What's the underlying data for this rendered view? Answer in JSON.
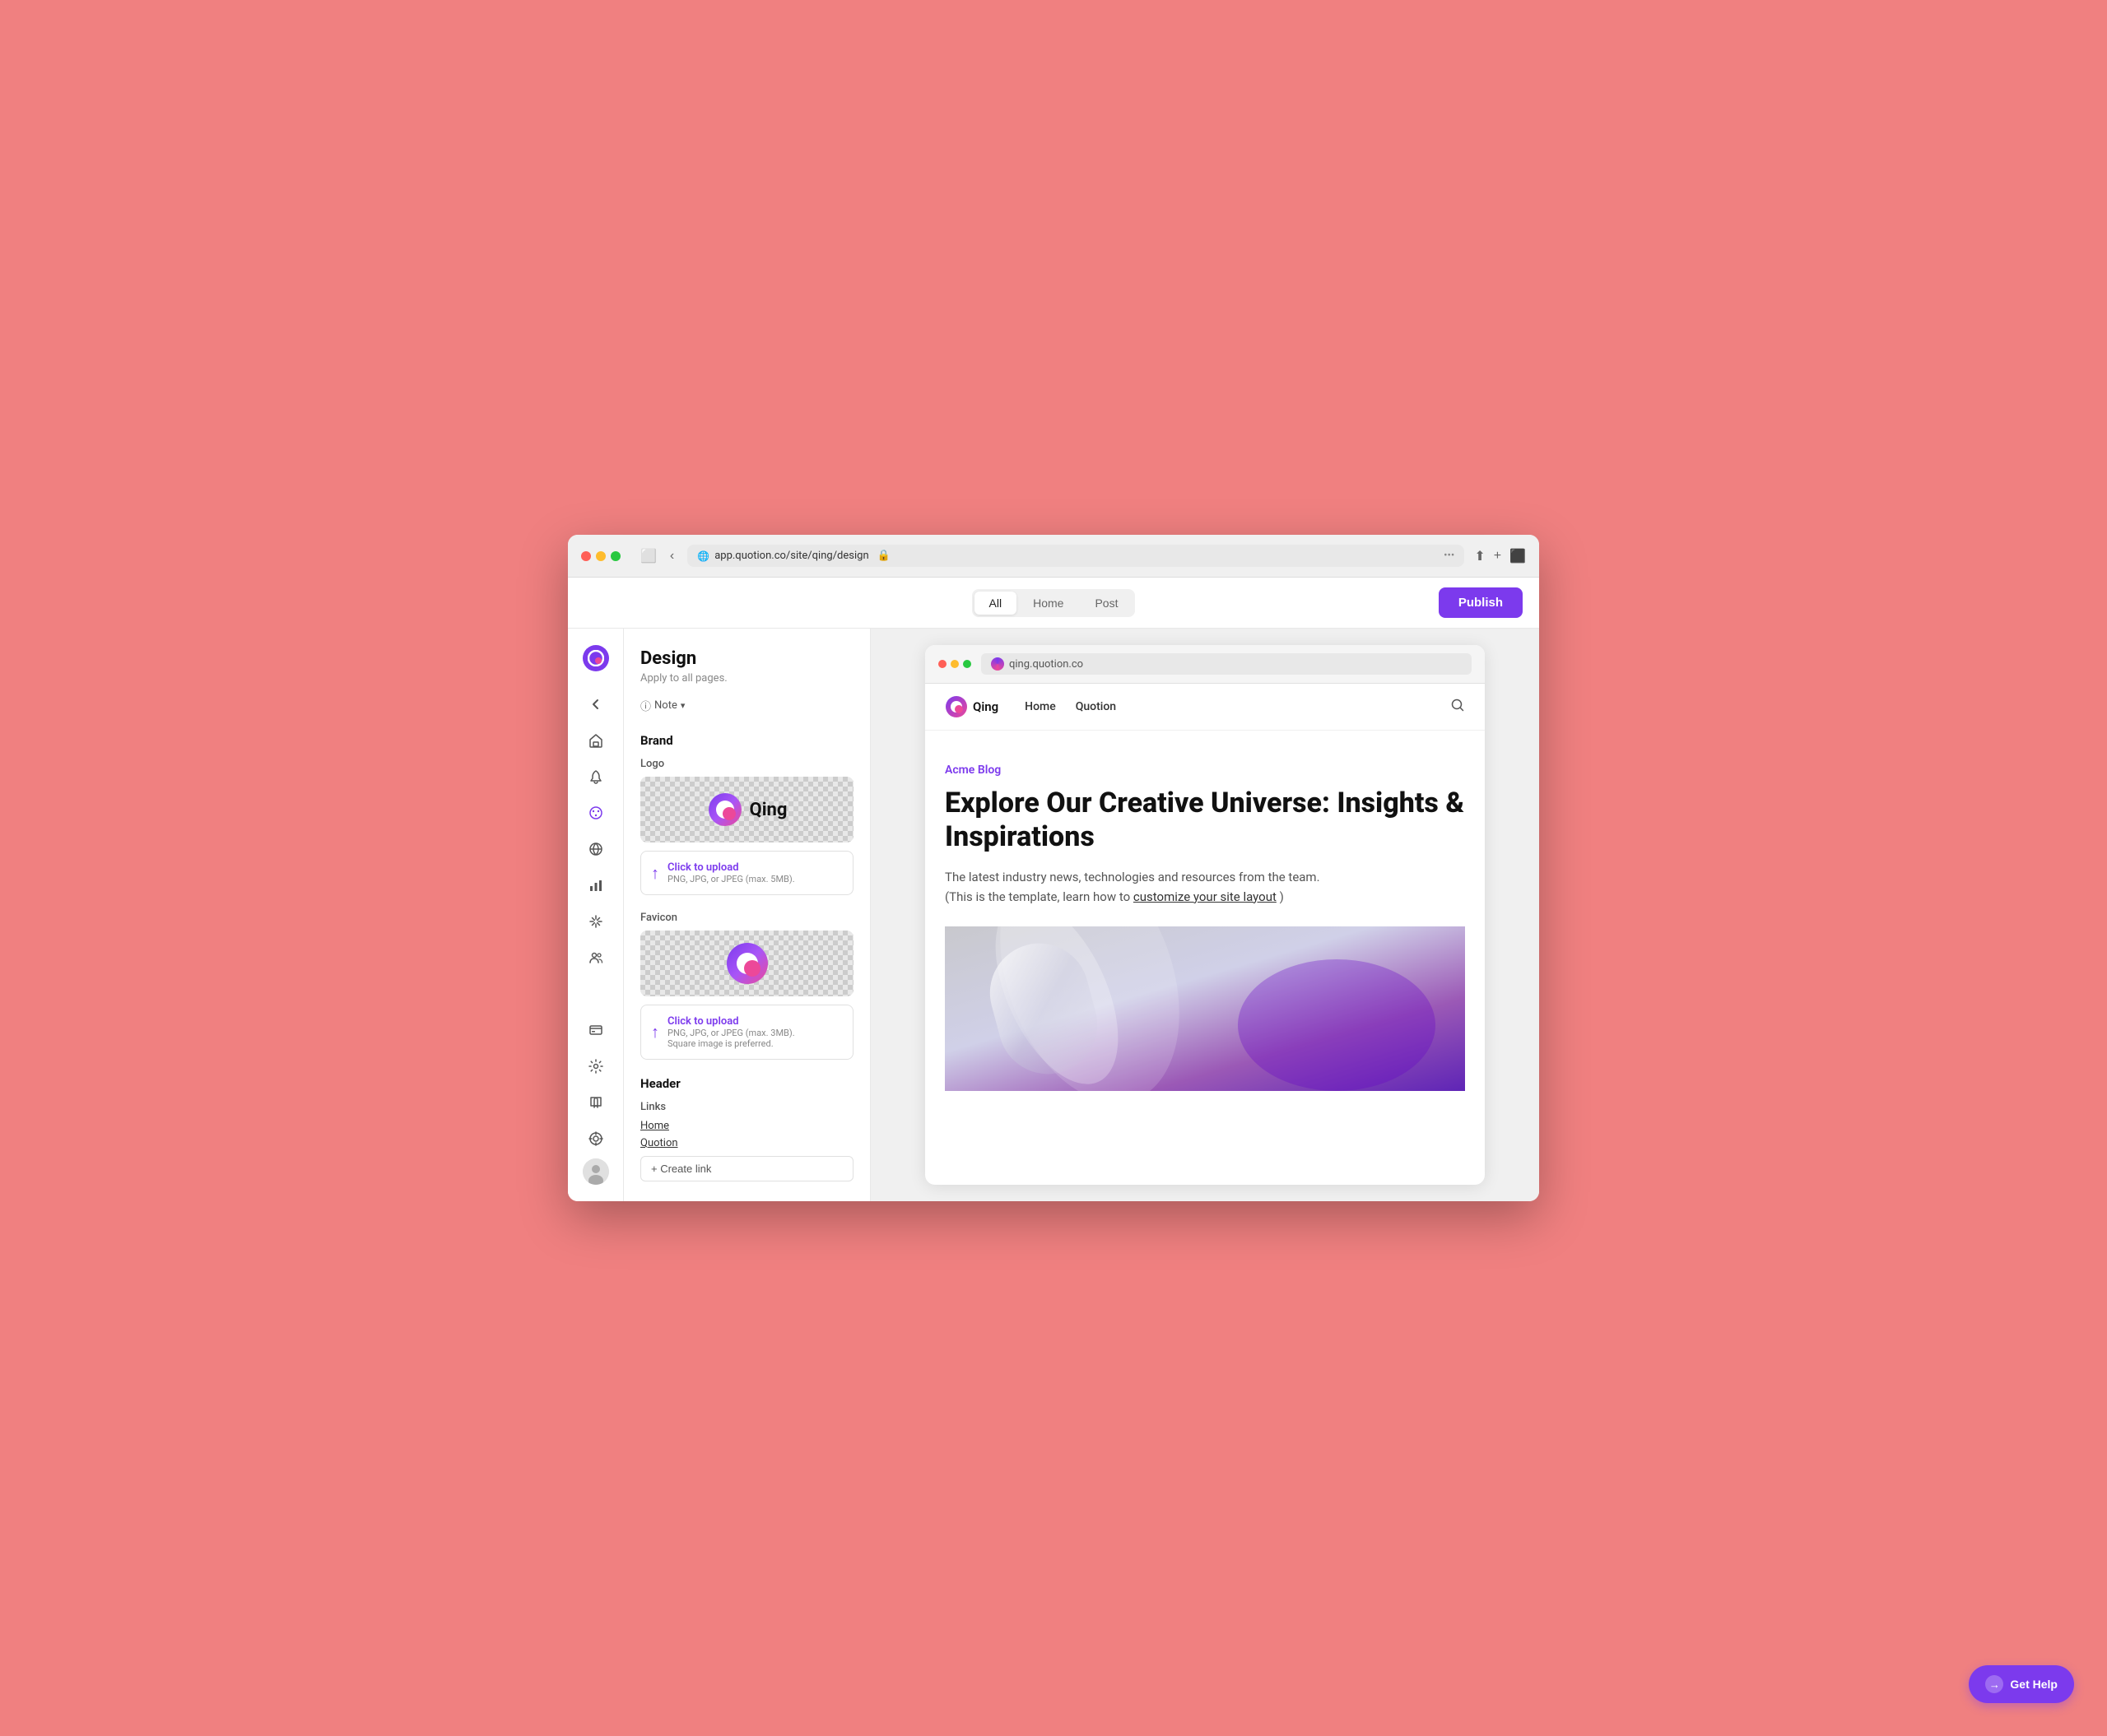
{
  "browser": {
    "url": "app.quotion.co/site/qing/design",
    "lock_icon": "🔒"
  },
  "topbar": {
    "tabs": [
      {
        "id": "all",
        "label": "All",
        "active": true
      },
      {
        "id": "home",
        "label": "Home",
        "active": false
      },
      {
        "id": "post",
        "label": "Post",
        "active": false
      }
    ],
    "publish_label": "Publish"
  },
  "sidebar": {
    "logo": "Q",
    "icons": [
      {
        "id": "back",
        "symbol": "←",
        "label": "back-icon"
      },
      {
        "id": "home",
        "symbol": "⌂",
        "label": "home-icon"
      },
      {
        "id": "rocket",
        "symbol": "🚀",
        "label": "rocket-icon"
      },
      {
        "id": "palette",
        "symbol": "🎨",
        "label": "palette-icon",
        "active": true
      },
      {
        "id": "globe",
        "symbol": "🌐",
        "label": "globe-icon"
      },
      {
        "id": "chart",
        "symbol": "📊",
        "label": "chart-icon"
      },
      {
        "id": "sparkle",
        "symbol": "✦",
        "label": "sparkle-icon"
      },
      {
        "id": "people",
        "symbol": "👥",
        "label": "people-icon"
      }
    ],
    "bottom_icons": [
      {
        "id": "card",
        "symbol": "💳",
        "label": "card-icon"
      },
      {
        "id": "settings",
        "symbol": "⚙",
        "label": "settings-icon"
      },
      {
        "id": "book",
        "symbol": "📖",
        "label": "book-icon"
      },
      {
        "id": "globe2",
        "symbol": "🌍",
        "label": "globe2-icon"
      }
    ]
  },
  "design_panel": {
    "title": "Design",
    "subtitle": "Apply to all pages.",
    "note_label": "Note",
    "brand": {
      "section_title": "Brand",
      "logo": {
        "label": "Logo",
        "brand_name": "Qing",
        "upload_label": "Click to upload",
        "upload_hint": "PNG, JPG, or JPEG (max. 5MB)."
      },
      "favicon": {
        "label": "Favicon",
        "upload_label": "Click to upload",
        "upload_hint": "PNG, JPG, or JPEG (max. 3MB).",
        "upload_hint2": "Square image is preferred."
      }
    },
    "header": {
      "section_title": "Header",
      "links_label": "Links",
      "links": [
        {
          "label": "Home",
          "url": "#"
        },
        {
          "label": "Quotion",
          "url": "#"
        }
      ],
      "create_link_label": "+ Create link"
    }
  },
  "site_preview": {
    "address": "qing.quotion.co",
    "nav": {
      "brand": "Qing",
      "links": [
        "Home",
        "Quotion"
      ]
    },
    "content": {
      "blog_label": "Acme Blog",
      "heading": "Explore Our Creative Universe: Insights & Inspirations",
      "description": "The latest industry news, technologies and resources from the team.",
      "template_note": "(This is the template, learn how to",
      "customize_link": "customize your site layout",
      "template_note_end": ")"
    }
  },
  "get_help": {
    "label": "Get Help",
    "icon": "→"
  }
}
